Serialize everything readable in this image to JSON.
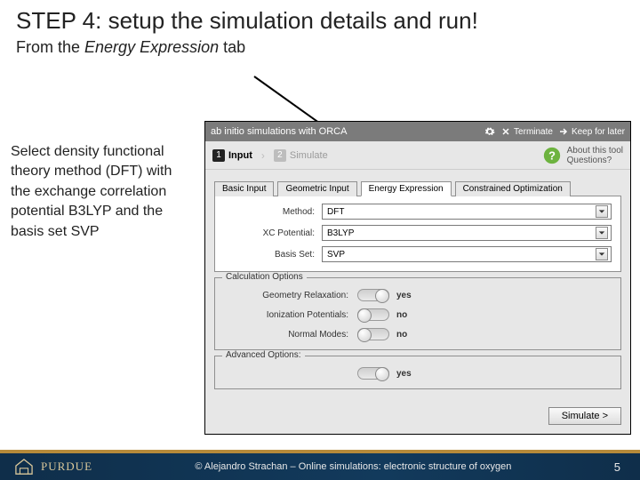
{
  "slide": {
    "title": "STEP 4: setup the simulation details and run!",
    "subtitle_prefix": "From the ",
    "subtitle_em": "Energy Expression",
    "subtitle_suffix": " tab",
    "instruction": "Select density functional theory method (DFT) with the exchange correlation potential B3LYP and the basis set SVP",
    "copyright": "© Alejandro Strachan – Online simulations: electronic structure of oxygen",
    "page_number": "5",
    "logo_text": "PURDUE"
  },
  "app": {
    "title": "ab initio simulations with ORCA",
    "actions": {
      "terminate": "Terminate",
      "keep": "Keep for later"
    },
    "steps": {
      "input": "Input",
      "simulate": "Simulate"
    },
    "hint": {
      "about": "About this tool",
      "questions": "Questions?"
    },
    "tabs": {
      "basic": "Basic Input",
      "geometric": "Geometric Input",
      "energy": "Energy Expression",
      "constrained": "Constrained Optimization"
    },
    "labels": {
      "method": "Method:",
      "xc": "XC Potential:",
      "basis": "Basis Set:"
    },
    "values": {
      "method": "DFT",
      "xc": "B3LYP",
      "basis": "SVP"
    },
    "fieldsets": {
      "calc": "Calculation Options",
      "adv": "Advanced Options:"
    },
    "toggles": {
      "geom_relax": {
        "label": "Geometry Relaxation:",
        "value": "yes"
      },
      "ion_pot": {
        "label": "Ionization Potentials:",
        "value": "no"
      },
      "normal": {
        "label": "Normal Modes:",
        "value": "no"
      },
      "adv": {
        "value": "yes"
      }
    },
    "button": "Simulate >"
  }
}
